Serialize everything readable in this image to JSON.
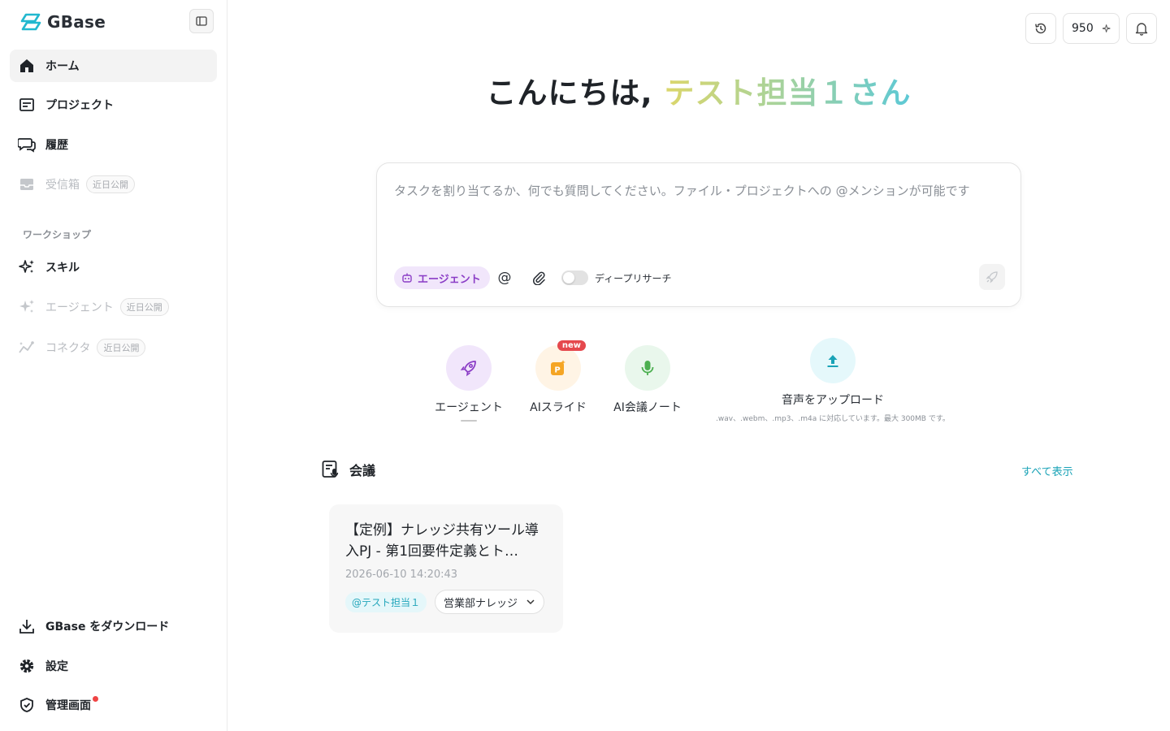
{
  "brand": {
    "name": "GBase"
  },
  "sidebar": {
    "nav": [
      {
        "label": "ホーム"
      },
      {
        "label": "プロジェクト"
      },
      {
        "label": "履歴"
      },
      {
        "label": "受信箱",
        "badge": "近日公開"
      }
    ],
    "section_label": "ワークショップ",
    "workshop": [
      {
        "label": "スキル"
      },
      {
        "label": "エージェント",
        "badge": "近日公開"
      },
      {
        "label": "コネクタ",
        "badge": "近日公開"
      }
    ],
    "bottom": [
      {
        "label": "GBase をダウンロード"
      },
      {
        "label": "設定"
      },
      {
        "label": "管理画面"
      }
    ]
  },
  "header": {
    "credits": "950"
  },
  "greeting": {
    "prefix": "こんにちは, ",
    "name": "テスト担当１さん"
  },
  "prompt": {
    "placeholder": "タスクを割り当てるか、何でも質問してください。ファイル・プロジェクトへの @メンションが可能です",
    "agent_chip": "エージェント",
    "deep_research": "ディープリサーチ"
  },
  "quick_actions": {
    "agent": "エージェント",
    "slides": "AIスライド",
    "slides_badge": "new",
    "notes": "AI会議ノート",
    "upload": "音声をアップロード",
    "upload_note": ".wav、.webm、.mp3、.m4a に対応しています。最大 300MB です。"
  },
  "meetings": {
    "title": "会議",
    "show_all": "すべて表示",
    "items": [
      {
        "title": "【定例】ナレッジ共有ツール導入PJ - 第1回要件定義とト…",
        "date": "2026-06-10 14:20:43",
        "mention": "@テスト担当１",
        "space": "営業部ナレッジ"
      }
    ]
  },
  "colors": {
    "accent_purple": "#8b3dc6",
    "accent_teal": "#1aa3b7",
    "badge_red": "#e5484d"
  }
}
